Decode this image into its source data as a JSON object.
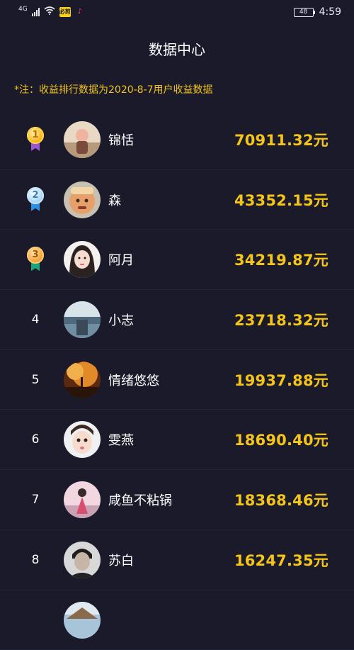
{
  "status_bar": {
    "network": "4G",
    "battery": "48",
    "time": "4:59",
    "app_badge_1": "必剪",
    "app_badge_2": "♪"
  },
  "page": {
    "title": "数据中心",
    "note": "*注：收益排行数据为2020-8-7用户收益数据"
  },
  "ranking": [
    {
      "rank": "1",
      "name": "锦恬",
      "amount": "70911.32元",
      "medal": "gold"
    },
    {
      "rank": "2",
      "name": "森",
      "amount": "43352.15元",
      "medal": "silver"
    },
    {
      "rank": "3",
      "name": "阿月",
      "amount": "34219.87元",
      "medal": "bronze"
    },
    {
      "rank": "4",
      "name": "小志",
      "amount": "23718.32元"
    },
    {
      "rank": "5",
      "name": "情绪悠悠",
      "amount": "19937.88元"
    },
    {
      "rank": "6",
      "name": "雯燕",
      "amount": "18690.40元"
    },
    {
      "rank": "7",
      "name": "咸鱼不粘锅",
      "amount": "18368.46元"
    },
    {
      "rank": "8",
      "name": "苏白",
      "amount": "16247.35元"
    }
  ]
}
